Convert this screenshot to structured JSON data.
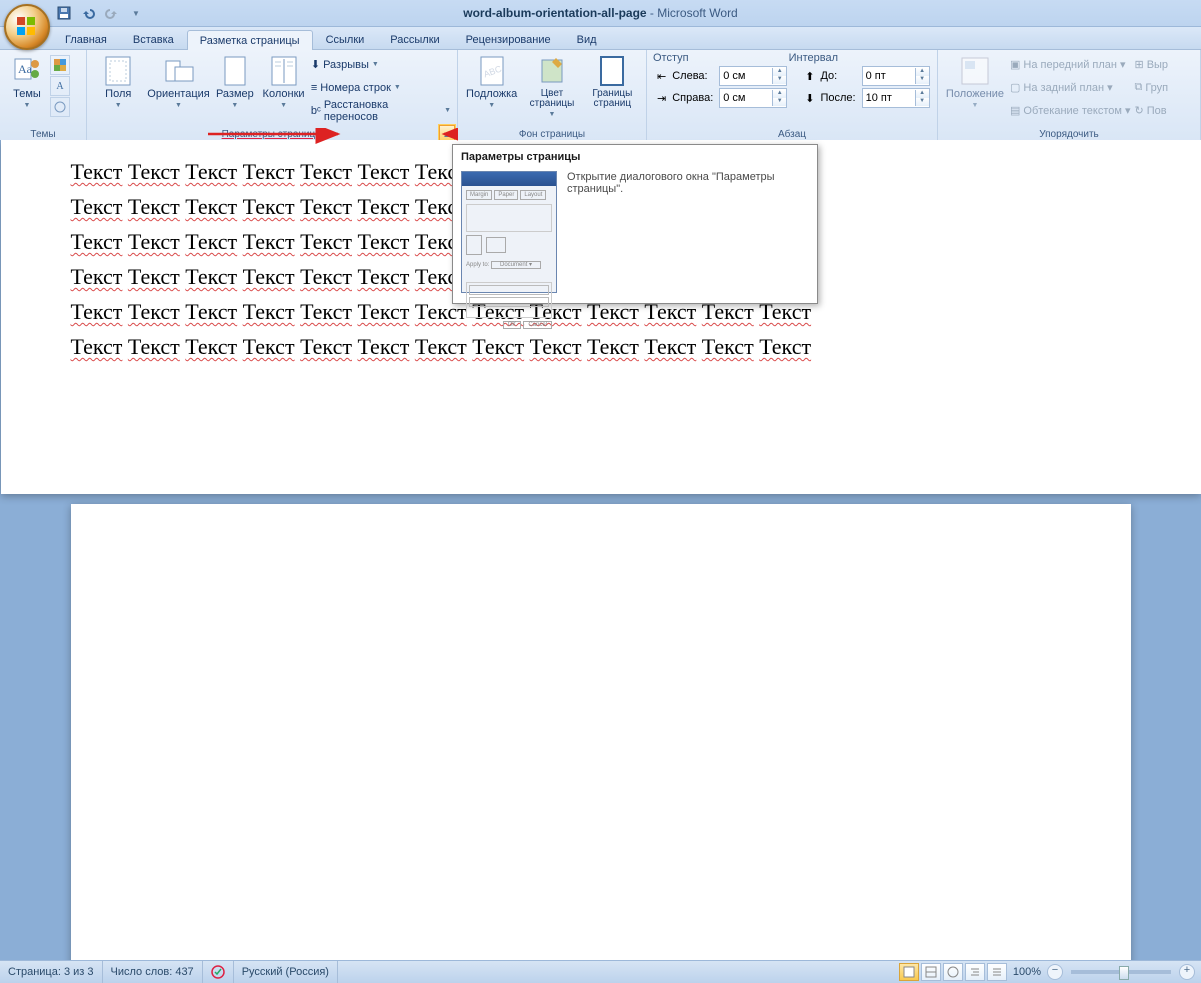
{
  "title": {
    "doc": "word-album-orientation-all-page",
    "app": "Microsoft Word",
    "sep": "  -  "
  },
  "tabs": [
    "Главная",
    "Вставка",
    "Разметка страницы",
    "Ссылки",
    "Рассылки",
    "Рецензирование",
    "Вид"
  ],
  "active_tab": 2,
  "groups": {
    "themes": {
      "label": "Темы",
      "btn": "Темы"
    },
    "page_setup": {
      "label": "Параметры страницы",
      "margins": "Поля",
      "orientation": "Ориентация",
      "size": "Размер",
      "columns": "Колонки",
      "breaks": "Разрывы",
      "line_numbers": "Номера строк",
      "hyphenation": "Расстановка переносов"
    },
    "page_bg": {
      "label": "Фон страницы",
      "watermark": "Подложка",
      "page_color": "Цвет страницы",
      "borders": "Границы страниц"
    },
    "paragraph": {
      "label": "Абзац",
      "indent_hdr": "Отступ",
      "left": "Слева:",
      "right": "Справа:",
      "left_val": "0 см",
      "right_val": "0 см",
      "spacing_hdr": "Интервал",
      "before": "До:",
      "after": "После:",
      "before_val": "0 пт",
      "after_val": "10 пт"
    },
    "arrange": {
      "label": "Упорядочить",
      "position": "Положение",
      "front": "На передний план",
      "back": "На задний план",
      "wrap": "Обтекание текстом",
      "align": "Выр",
      "group": "Груп",
      "rotate": "Пов"
    }
  },
  "tooltip": {
    "title": "Параметры страницы",
    "desc": "Открытие диалогового окна \"Параметры страницы\"."
  },
  "document": {
    "word": "Текст",
    "rows": 6,
    "cols": 13
  },
  "status": {
    "page": "Страница: 3 из 3",
    "words": "Число слов: 437",
    "lang": "Русский (Россия)",
    "zoom": "100%"
  }
}
